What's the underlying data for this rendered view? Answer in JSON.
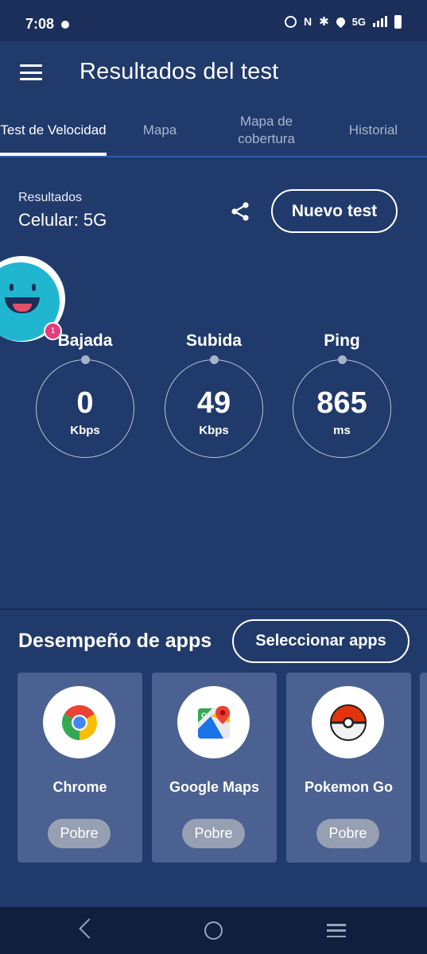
{
  "status_bar": {
    "time": "7:08",
    "network": "5G"
  },
  "header": {
    "title": "Resultados del test"
  },
  "tabs": [
    {
      "label": "Test de Velocidad",
      "active": true
    },
    {
      "label": "Mapa",
      "active": false
    },
    {
      "label": "Mapa de cobertura",
      "active": false
    },
    {
      "label": "Historial",
      "active": false
    }
  ],
  "results": {
    "label": "Resultados",
    "connection": "Celular: 5G",
    "new_test_label": "Nuevo test"
  },
  "mascot": {
    "badge_count": "1"
  },
  "metrics": [
    {
      "label": "Bajada",
      "value": "0",
      "unit": "Kbps"
    },
    {
      "label": "Subida",
      "value": "49",
      "unit": "Kbps"
    },
    {
      "label": "Ping",
      "value": "865",
      "unit": "ms"
    }
  ],
  "apps_section": {
    "title": "Desempeño de apps",
    "select_label": "Seleccionar apps",
    "apps": [
      {
        "name": "Chrome",
        "rating": "Pobre",
        "icon": "chrome-icon"
      },
      {
        "name": "Google Maps",
        "rating": "Pobre",
        "icon": "google-maps-icon"
      },
      {
        "name": "Pokemon Go",
        "rating": "Pobre",
        "icon": "pokeball-icon"
      }
    ]
  },
  "colors": {
    "background": "#213a6c",
    "card": "#4a6191",
    "badge": "#e23d7a",
    "mascot": "#21b6cf"
  }
}
